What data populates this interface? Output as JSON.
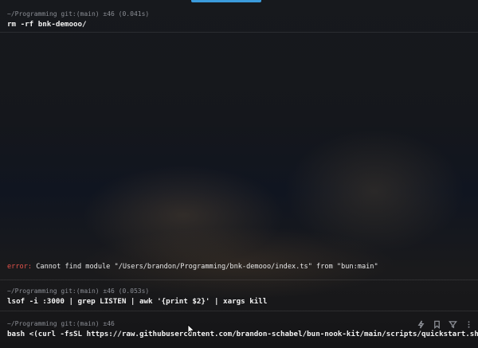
{
  "colors": {
    "background": "#0d0f14",
    "prompt": "#8b8e95",
    "command": "#f2f2f2",
    "error_label": "#e5534b",
    "accent": "#3b9bdc"
  },
  "blocks": [
    {
      "prompt": "~/Programming git:(main) ±46 (0.041s)",
      "command": "rm -rf bnk-demooo/"
    },
    {
      "error_label": "error:",
      "error_message": " Cannot find module \"/Users/brandon/Programming/bnk-demooo/index.ts\" from \"bun:main\""
    },
    {
      "prompt": "~/Programming git:(main) ±46 (0.053s)",
      "command": "lsof -i :3000 | grep LISTEN | awk '{print $2}' | xargs kill"
    },
    {
      "prompt": "~/Programming git:(main) ±46",
      "command": "bash <(curl -fsSL https://raw.githubusercontent.com/brandon-schabel/bun-nook-kit/main/scripts/quickstart.sh)"
    }
  ],
  "toolbar": {
    "icons": [
      "lightning-icon",
      "bookmark-icon",
      "filter-icon",
      "more-vertical-icon"
    ]
  }
}
